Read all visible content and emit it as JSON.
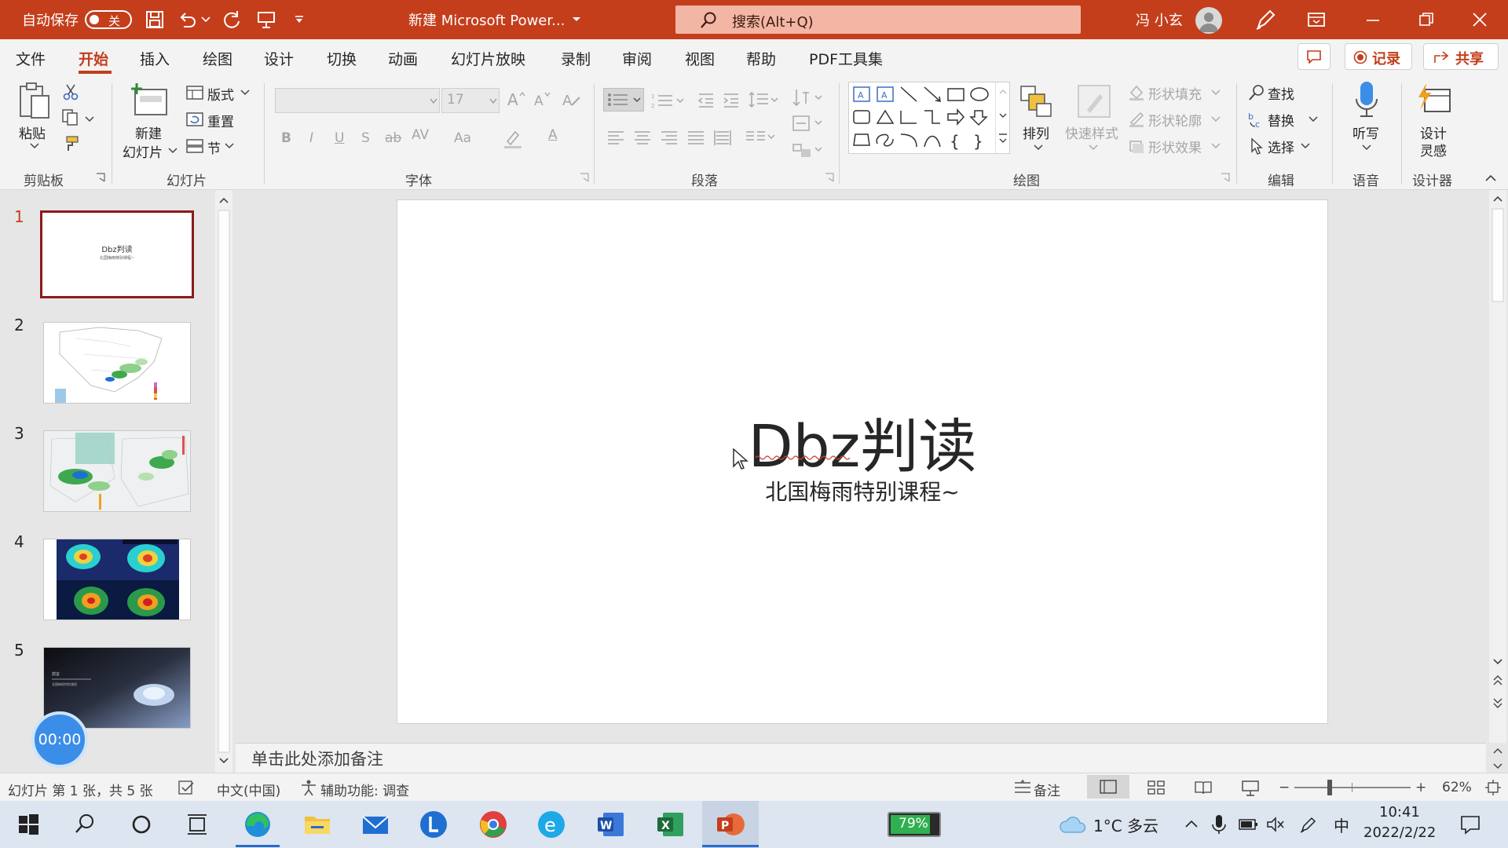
{
  "titlebar": {
    "autosave_label": "自动保存",
    "autosave_state": "关",
    "doc_title": "新建 Microsoft Power...",
    "search_placeholder": "搜索(Alt+Q)",
    "user_name": "冯 小玄",
    "bg_color": "#c43e1c"
  },
  "menu": {
    "items": [
      "文件",
      "开始",
      "插入",
      "绘图",
      "设计",
      "切换",
      "动画",
      "幻灯片放映",
      "录制",
      "审阅",
      "视图",
      "帮助",
      "PDF工具集"
    ],
    "active": "开始",
    "record_label": "记录",
    "share_label": "共享"
  },
  "ribbon": {
    "clipboard": {
      "paste": "粘贴",
      "group": "剪贴板"
    },
    "slides": {
      "new_slide_1": "新建",
      "new_slide_2": "幻灯片",
      "layout": "版式",
      "reset": "重置",
      "section": "节",
      "group": "幻灯片"
    },
    "font": {
      "size": "17",
      "group": "字体",
      "bold": "B",
      "italic": "I",
      "underline": "U",
      "strike": "S",
      "abc": "ab",
      "spacing": "AV",
      "case": "Aa",
      "color": "A"
    },
    "paragraph": {
      "group": "段落"
    },
    "drawing": {
      "arrange": "排列",
      "quick_styles": "快速样式",
      "fill": "形状填充",
      "outline": "形状轮廓",
      "effects": "形状效果",
      "group": "绘图"
    },
    "editing": {
      "find": "查找",
      "replace": "替换",
      "select": "选择",
      "group": "编辑"
    },
    "voice": {
      "dictate": "听写",
      "group": "语音"
    },
    "designer": {
      "label_1": "设计",
      "label_2": "灵感",
      "group": "设计器"
    }
  },
  "thumbnails": [
    {
      "num": "1",
      "title": "Dbz判读",
      "subtitle": "北国梅雨特别课程~",
      "selected": true
    },
    {
      "num": "2"
    },
    {
      "num": "3"
    },
    {
      "num": "4"
    },
    {
      "num": "5",
      "title": "前言",
      "subtitle": "北国梅雨特别课程"
    }
  ],
  "timer": "00:00",
  "slide": {
    "title": "Dbz判读",
    "subtitle": "北国梅雨特别课程~"
  },
  "notes_placeholder": "单击此处添加备注",
  "status": {
    "slide_info": "幻灯片 第 1 张，共 5 张",
    "language": "中文(中国)",
    "accessibility": "辅助功能: 调查",
    "notes": "备注",
    "zoom_minus": "−",
    "zoom_plus": "+",
    "zoom": "62%"
  },
  "taskbar": {
    "battery": "79%",
    "weather": "1°C 多云",
    "ime": "中",
    "time": "10:41",
    "date": "2022/2/22"
  },
  "colors": {
    "accent": "#c43e1c",
    "thumb_border": "#8b1a1a",
    "timer": "#3b8ee8"
  }
}
